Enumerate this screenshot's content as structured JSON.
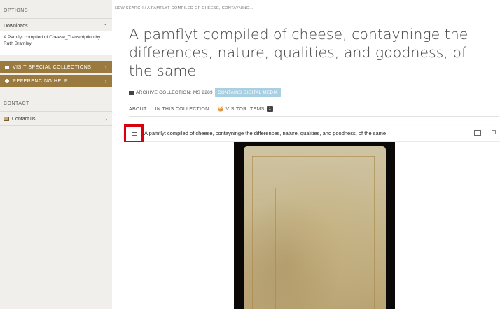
{
  "sidebar": {
    "options_heading": "OPTIONS",
    "downloads_label": "Downloads",
    "download_item": "A Pamflyt compiled of Cheese_Transcription by Ruth Bramley",
    "visit_label": "VISIT SPECIAL COLLECTIONS",
    "referencing_label": "REFERENCING HELP",
    "contact_heading": "CONTACT",
    "contact_us_label": "Contact us",
    "accent_color": "#9a7a3e"
  },
  "breadcrumb": "NEW SEARCH / A PAMFLYT COMPILED OF CHEESE, CONTAYNING...",
  "item": {
    "title": "A pamflyt compiled of cheese, contayninge the differences, nature, qualities, and goodness, of the same",
    "collection_label": "ARCHIVE COLLECTION: MS 2289",
    "digital_badge": "CONTAINS DIGITAL MEDIA",
    "badge_color": "#a9cfe2"
  },
  "tabs": {
    "about": "ABOUT",
    "in_collection": "IN THIS COLLECTION",
    "visitor_items": "VISITOR ITEMS",
    "visitor_count": "1"
  },
  "viewer": {
    "title": "A pamflyt compiled of cheese, contayninge the differences, nature, qualities, and goodness, of the same",
    "highlight_color": "#d7000f"
  },
  "icons": [
    "chevron-up-icon",
    "chevron-right-icon",
    "archive-box-icon",
    "basket-icon",
    "menu-icon",
    "book-view-icon",
    "fullscreen-icon",
    "mail-icon"
  ]
}
